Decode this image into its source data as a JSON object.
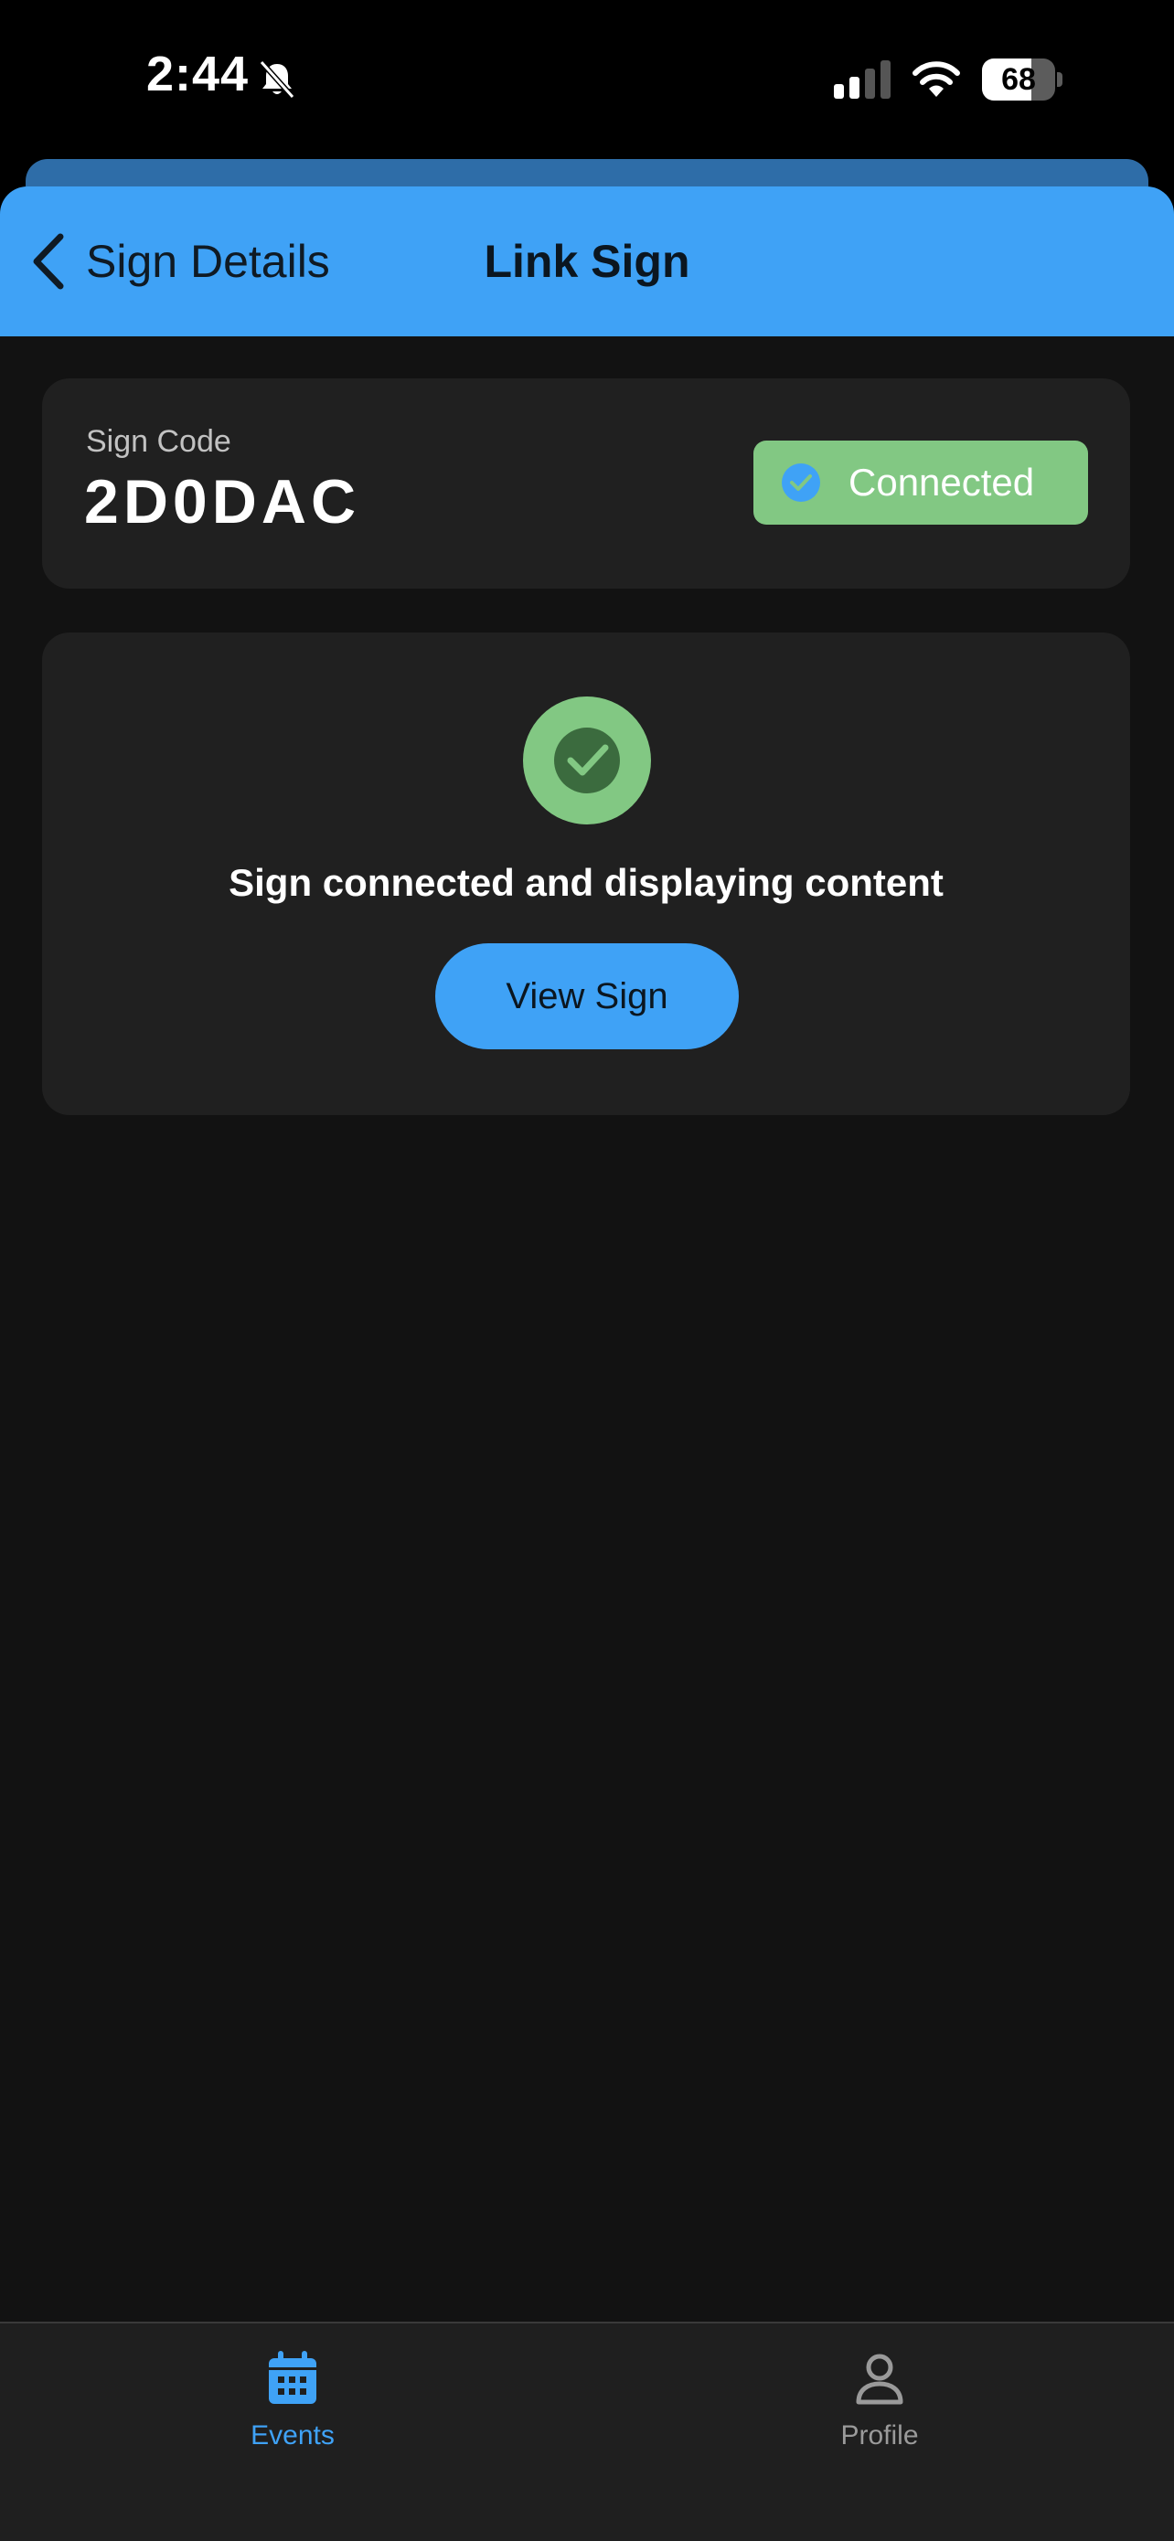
{
  "status_bar": {
    "time": "2:44",
    "battery": "68",
    "battery_level": 0.68
  },
  "header": {
    "back_label": "Sign Details",
    "title": "Link Sign"
  },
  "sign": {
    "code_label": "Sign Code",
    "code": "2D0DAC",
    "status": "Connected"
  },
  "status_card": {
    "message": "Sign connected and displaying content",
    "button_label": "View Sign"
  },
  "tabs": [
    {
      "label": "Events",
      "icon": "calendar-icon",
      "active": true
    },
    {
      "label": "Profile",
      "icon": "person-icon",
      "active": false
    }
  ],
  "colors": {
    "accent": "#3fa2f6",
    "success": "#82c883",
    "background": "#121212",
    "card": "#202020"
  }
}
